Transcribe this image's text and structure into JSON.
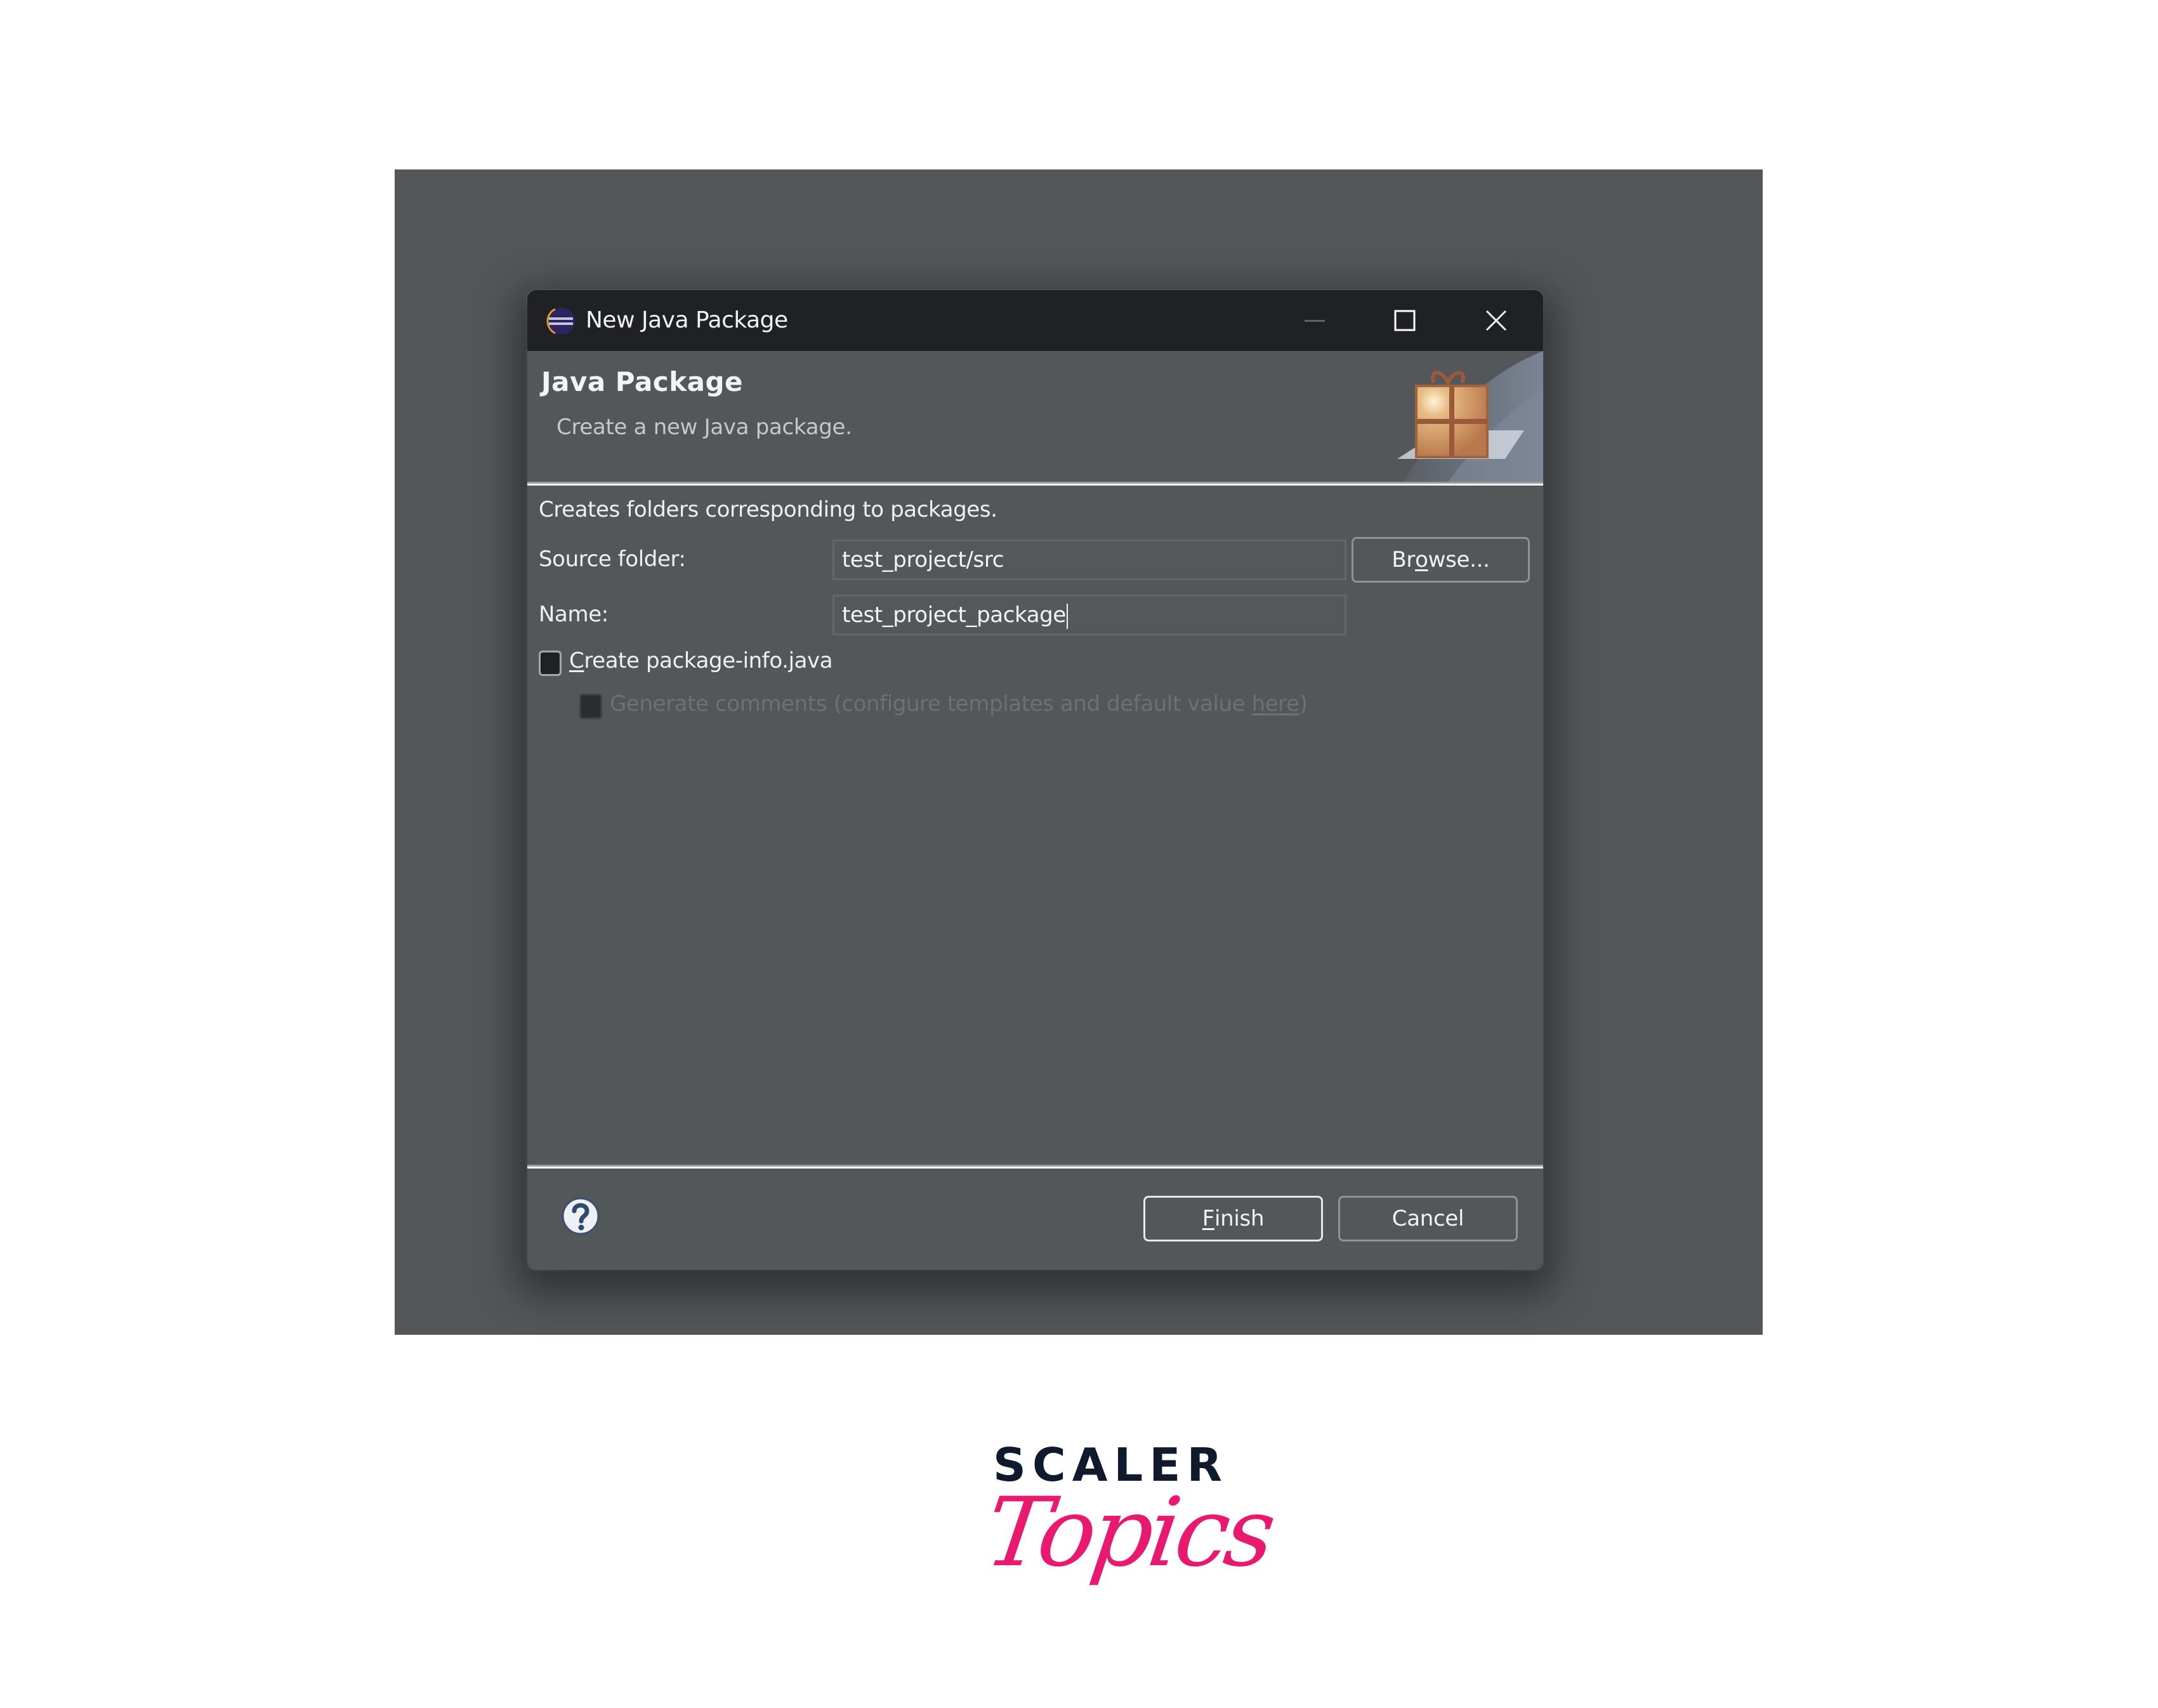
{
  "window": {
    "title": "New Java Package",
    "controls": {
      "minimize_icon": "minimize-icon",
      "maximize_icon": "maximize-icon",
      "close_icon": "close-icon"
    }
  },
  "header": {
    "title": "Java Package",
    "subtitle": "Create a new Java package."
  },
  "body": {
    "description": "Creates folders corresponding to packages.",
    "source_folder": {
      "label": "Source folder:",
      "value": "test_project/src",
      "browse_label_pre": "Br",
      "browse_label_mnemonic": "o",
      "browse_label_post": "wse..."
    },
    "name": {
      "label": "Name:",
      "value": "test_project_package"
    },
    "create_package_info": {
      "label_mnemonic": "C",
      "label_rest": "reate package-info.java",
      "checked": false
    },
    "generate_comments": {
      "label": "Generate comments  (configure templates and default value ",
      "link": "here",
      "suffix": ")",
      "checked": false,
      "enabled": false
    }
  },
  "footer": {
    "help_icon": "help-icon",
    "finish_mnemonic": "F",
    "finish_rest": "inish",
    "cancel_label": "Cancel"
  },
  "branding": {
    "line1": "SCALER",
    "line2": "Topics",
    "colors": {
      "scaler": "#0f1a2c",
      "topics": "#e8196f"
    }
  }
}
